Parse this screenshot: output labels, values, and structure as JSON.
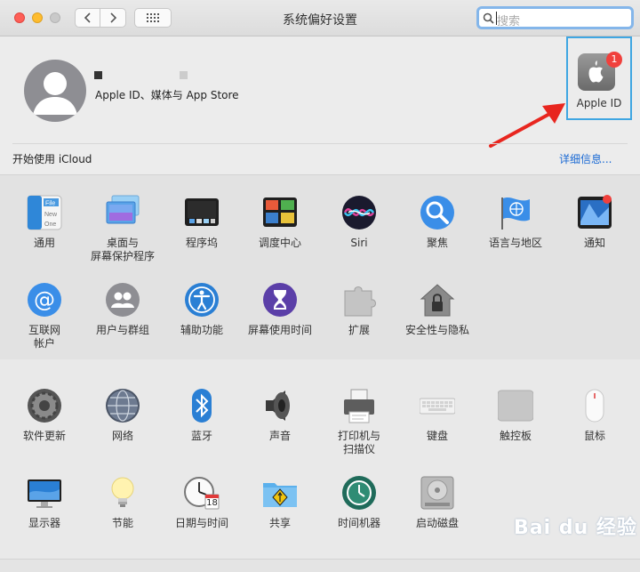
{
  "window": {
    "title": "系统偏好设置"
  },
  "search": {
    "placeholder": "搜索"
  },
  "account": {
    "subtitle": "Apple ID、媒体与 App Store"
  },
  "apple_id": {
    "label": "Apple ID",
    "badge": "1"
  },
  "icloud": {
    "prompt": "开始使用 iCloud",
    "details_link": "详细信息..."
  },
  "row1": [
    {
      "name": "pref-general",
      "label": "通用",
      "icon": "general-icon"
    },
    {
      "name": "pref-desktop-screensaver",
      "label": "桌面与\n屏幕保护程序",
      "icon": "desktop-icon"
    },
    {
      "name": "pref-dock",
      "label": "程序坞",
      "icon": "dock-icon"
    },
    {
      "name": "pref-mission-control",
      "label": "调度中心",
      "icon": "mission-control-icon"
    },
    {
      "name": "pref-siri",
      "label": "Siri",
      "icon": "siri-icon"
    },
    {
      "name": "pref-spotlight",
      "label": "聚焦",
      "icon": "spotlight-icon"
    },
    {
      "name": "pref-language-region",
      "label": "语言与地区",
      "icon": "globe-flag-icon"
    },
    {
      "name": "pref-notifications",
      "label": "通知",
      "icon": "notifications-icon"
    }
  ],
  "row2": [
    {
      "name": "pref-internet-accounts",
      "label": "互联网\n帐户",
      "icon": "at-icon"
    },
    {
      "name": "pref-users-groups",
      "label": "用户与群组",
      "icon": "users-icon"
    },
    {
      "name": "pref-accessibility",
      "label": "辅助功能",
      "icon": "accessibility-icon"
    },
    {
      "name": "pref-screen-time",
      "label": "屏幕使用时间",
      "icon": "hourglass-icon"
    },
    {
      "name": "pref-extensions",
      "label": "扩展",
      "icon": "puzzle-icon"
    },
    {
      "name": "pref-security-privacy",
      "label": "安全性与隐私",
      "icon": "house-lock-icon"
    }
  ],
  "row3": [
    {
      "name": "pref-software-update",
      "label": "软件更新",
      "icon": "gear-update-icon"
    },
    {
      "name": "pref-network",
      "label": "网络",
      "icon": "network-globe-icon"
    },
    {
      "name": "pref-bluetooth",
      "label": "蓝牙",
      "icon": "bluetooth-icon"
    },
    {
      "name": "pref-sound",
      "label": "声音",
      "icon": "speaker-icon"
    },
    {
      "name": "pref-printers-scanners",
      "label": "打印机与\n扫描仪",
      "icon": "printer-icon"
    },
    {
      "name": "pref-keyboard",
      "label": "键盘",
      "icon": "keyboard-icon"
    },
    {
      "name": "pref-trackpad",
      "label": "触控板",
      "icon": "trackpad-icon"
    },
    {
      "name": "pref-mouse",
      "label": "鼠标",
      "icon": "mouse-icon"
    }
  ],
  "row4": [
    {
      "name": "pref-displays",
      "label": "显示器",
      "icon": "display-icon"
    },
    {
      "name": "pref-energy-saver",
      "label": "节能",
      "icon": "lightbulb-icon"
    },
    {
      "name": "pref-date-time",
      "label": "日期与时间",
      "icon": "clock-calendar-icon",
      "calendar_day": "18"
    },
    {
      "name": "pref-sharing",
      "label": "共享",
      "icon": "sharing-folder-icon"
    },
    {
      "name": "pref-time-machine",
      "label": "时间机器",
      "icon": "time-machine-icon"
    },
    {
      "name": "pref-startup-disk",
      "label": "启动磁盘",
      "icon": "disk-icon"
    }
  ],
  "watermark": "Bai du 经验"
}
